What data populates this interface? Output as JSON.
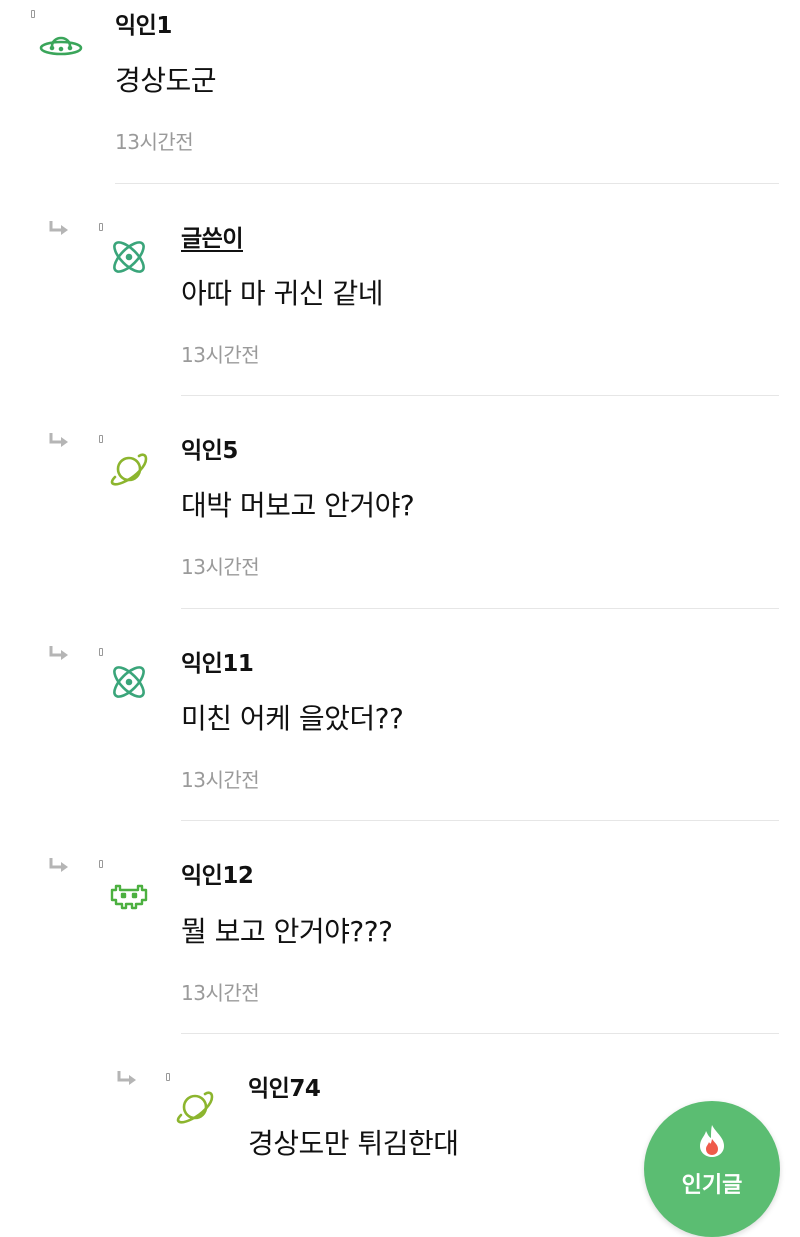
{
  "comments": [
    {
      "author": "익인1",
      "text": "경상도군",
      "time": "13시간전",
      "avatar": "ufo-icon"
    },
    {
      "author": "글쓴이",
      "text": "아따 마 귀신 같네",
      "time": "13시간전",
      "avatar": "atom-icon"
    },
    {
      "author": "익인5",
      "text": "대박 머보고 안거야?",
      "time": "13시간전",
      "avatar": "planet-icon"
    },
    {
      "author": "익인11",
      "text": "미친 어케 을았더??",
      "time": "13시간전",
      "avatar": "atom-icon"
    },
    {
      "author": "익인12",
      "text": "뭘 보고 안거야???",
      "time": "13시간전",
      "avatar": "space-invader-icon"
    },
    {
      "author": "익인74",
      "text": "경상도만 튀김한대",
      "time": "",
      "avatar": "planet-icon"
    }
  ],
  "fab": {
    "label": "인기글",
    "icon": "flame-icon",
    "color": "#5bbd72"
  },
  "colors": {
    "accent": "#5bbd72",
    "timestamp": "#9a9a9a",
    "divider": "#e6e6e6"
  }
}
